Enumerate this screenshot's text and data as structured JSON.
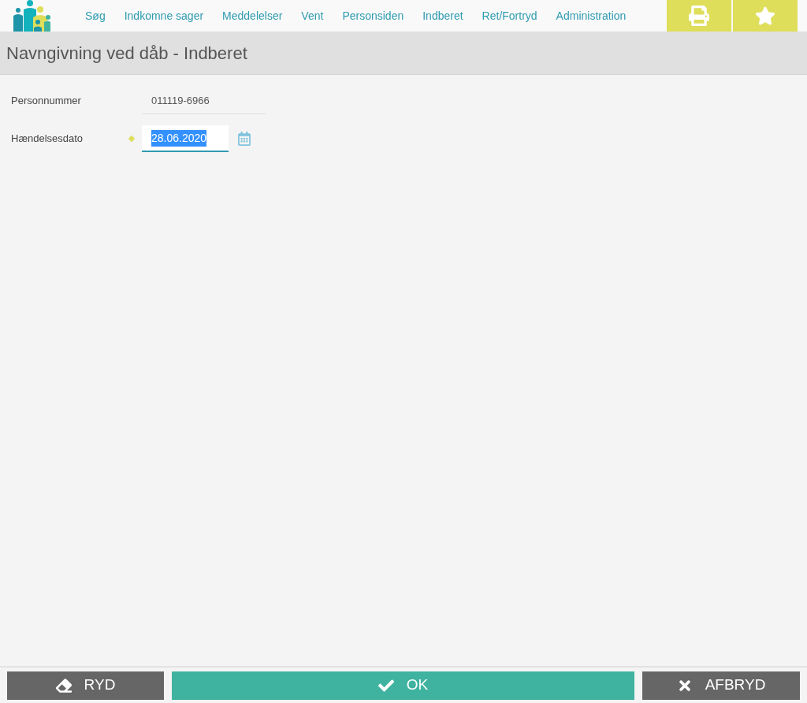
{
  "nav": [
    {
      "label": "Søg"
    },
    {
      "label": "Indkomne sager"
    },
    {
      "label": "Meddelelser"
    },
    {
      "label": "Vent"
    },
    {
      "label": "Personsiden"
    },
    {
      "label": "Indberet"
    },
    {
      "label": "Ret/Fortryd"
    },
    {
      "label": "Administration"
    }
  ],
  "page_title": "Navngivning ved dåb - Indberet",
  "fields": [
    {
      "kind": "readonly",
      "label": "Personnummer",
      "value": "011119-6966",
      "required": false
    },
    {
      "kind": "date",
      "label": "Hændelsesdato",
      "value": "28.06.2020",
      "required": true,
      "selected": true
    }
  ],
  "buttons": [
    {
      "kind": "clear",
      "label": "RYD"
    },
    {
      "kind": "ok",
      "label": "OK"
    },
    {
      "kind": "cancel",
      "label": "AFBRYD"
    }
  ]
}
